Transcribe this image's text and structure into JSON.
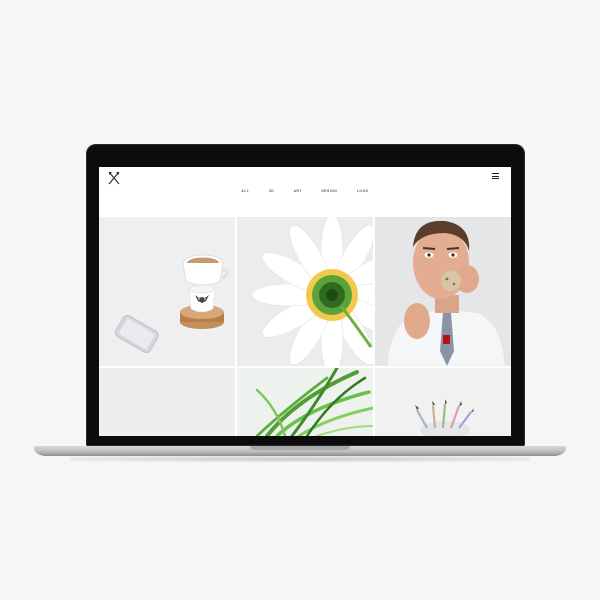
{
  "site": {
    "filters": [
      "ALL",
      "3D",
      "ART",
      "DESIGN",
      "LOGO"
    ]
  },
  "icons": {
    "logo": "crossed-arrows-logo",
    "menu": "hamburger-menu-icon"
  },
  "gallery": {
    "tiles": [
      {
        "subject": "coffee-cup-and-phone"
      },
      {
        "subject": "white-daisy"
      },
      {
        "subject": "man-eating-cookie"
      },
      {
        "subject": "blank-light-gray"
      },
      {
        "subject": "green-grass"
      },
      {
        "subject": "pencils-in-cup"
      }
    ]
  },
  "colors": {
    "page_background": "#f6f6f6",
    "laptop_bezel": "#0c0c0c",
    "screen_background": "#ffffff",
    "text": "#555555"
  }
}
